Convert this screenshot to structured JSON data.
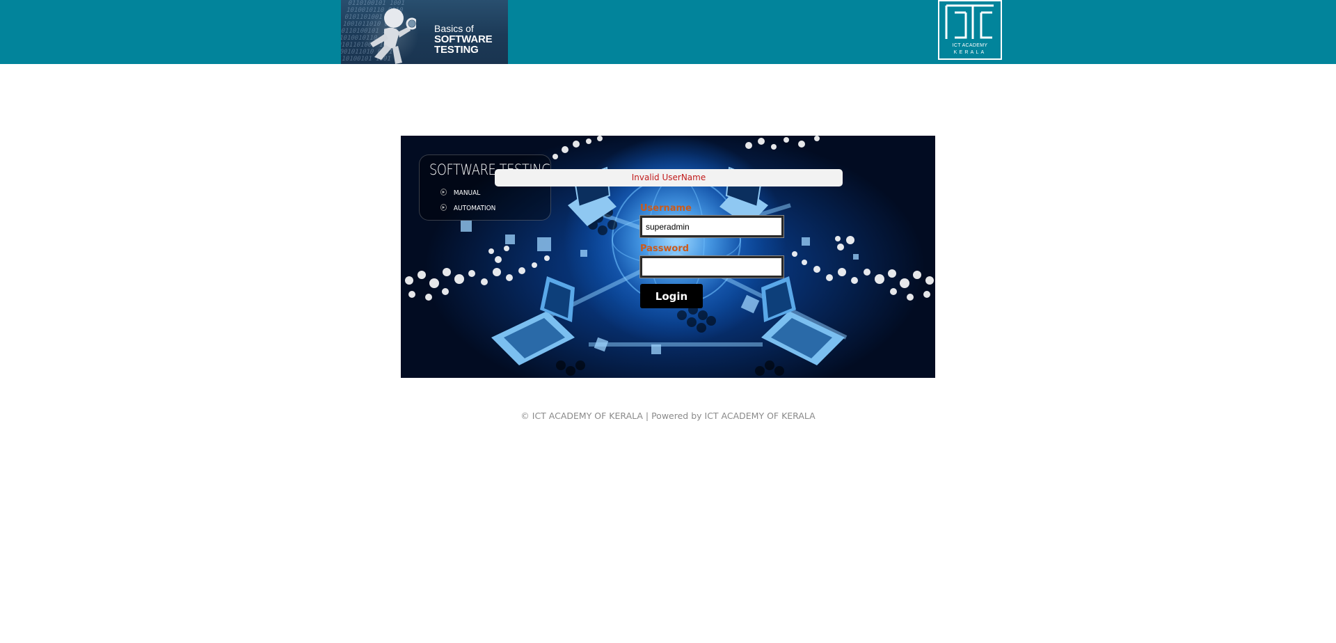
{
  "header": {
    "banner": {
      "line1": "Basics of",
      "line2": "SOFTWARE",
      "line3": "TESTING"
    },
    "logo": {
      "mark": "ICT",
      "line1": "ICT ACADEMY",
      "line2": "KERALA"
    }
  },
  "panel": {
    "title": "SOFTWARE TESTING",
    "menu": [
      {
        "label": "MANUAL",
        "icon": "bullet-arrow-icon"
      },
      {
        "label": "AUTOMATION",
        "icon": "bullet-arrow-icon"
      }
    ]
  },
  "login": {
    "error_message": "Invalid UserName",
    "username_label": "Username",
    "username_value": "superadmin",
    "password_label": "Password",
    "password_value": "",
    "button_label": "Login"
  },
  "footer": {
    "text": "© ICT ACADEMY OF KERALA | Powered by ICT ACADEMY OF KERALA"
  },
  "colors": {
    "header_bg": "#02849b",
    "error_text": "#c11b1b",
    "label_text": "#cc5a1a",
    "footer_text": "#8a8a8a"
  }
}
